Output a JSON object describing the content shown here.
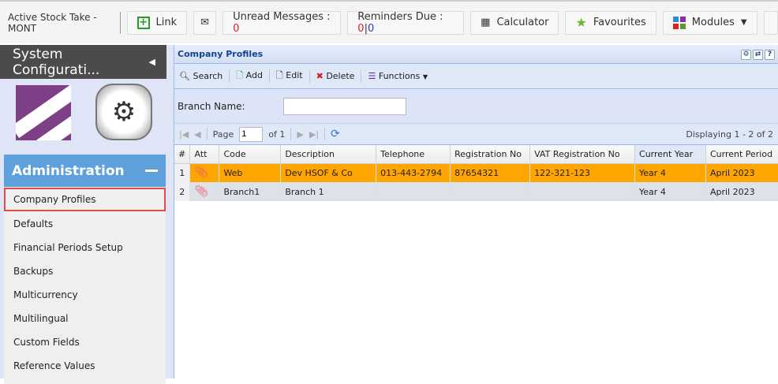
{
  "topbar": {
    "active": "Active Stock Take - MONT",
    "link": "Link",
    "unread_label": "Unread Messages : ",
    "unread_count": "0",
    "reminders_label": "Reminders Due : ",
    "reminders_a": "0",
    "reminders_sep": "|",
    "reminders_b": "0",
    "calculator": "Calculator",
    "favourites": "Favourites",
    "modules": "Modules"
  },
  "sidebar": {
    "title": "System Configurati...",
    "section": "Administration",
    "items": [
      {
        "label": "Company Profiles"
      },
      {
        "label": "Defaults"
      },
      {
        "label": "Financial Periods Setup"
      },
      {
        "label": "Backups"
      },
      {
        "label": "Multicurrency"
      },
      {
        "label": "Multilingual"
      },
      {
        "label": "Custom Fields"
      },
      {
        "label": "Reference Values"
      }
    ]
  },
  "panel": {
    "title": "Company Profiles",
    "toolbar": {
      "search": "Search",
      "add": "Add",
      "edit": "Edit",
      "delete": "Delete",
      "functions": "Functions"
    },
    "form": {
      "branch_label": "Branch Name:",
      "branch_value": ""
    },
    "pager": {
      "page_label": "Page",
      "page": "1",
      "of": "of 1",
      "displaying": "Displaying 1 - 2 of 2"
    },
    "columns": [
      "#",
      "Att",
      "Code",
      "Description",
      "Telephone",
      "Registration No",
      "VAT Registration No",
      "Current Year",
      "Current Period"
    ],
    "rows": [
      [
        "1",
        "",
        "Web",
        "Dev HSOF & Co",
        "013-443-2794",
        "87654321",
        "122-321-123",
        "Year 4",
        "April 2023"
      ],
      [
        "2",
        "",
        "Branch1",
        "Branch 1",
        "",
        "",
        "",
        "Year 4",
        "April 2023"
      ]
    ]
  },
  "colors": {
    "selected_row": "#ffa500",
    "admin_header": "#5ea0dc",
    "highlight_border": "#e34b4b"
  }
}
